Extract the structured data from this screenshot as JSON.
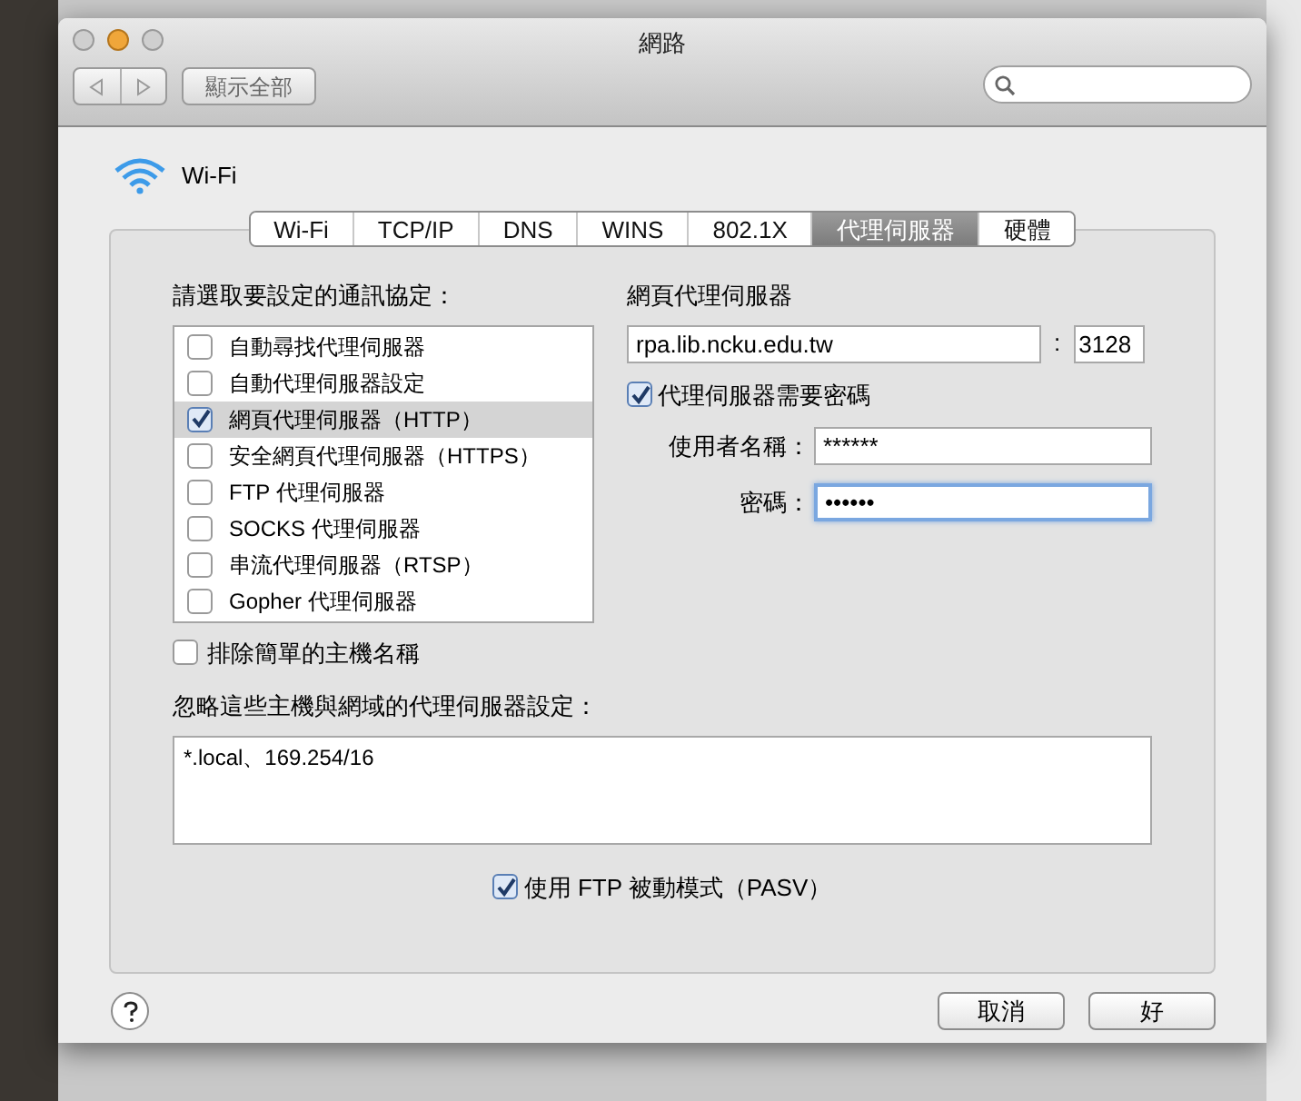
{
  "window": {
    "title": "網路"
  },
  "toolbar": {
    "show_all": "顯示全部"
  },
  "service": {
    "name": "Wi-Fi"
  },
  "tabs": [
    {
      "label": "Wi-Fi",
      "selected": false
    },
    {
      "label": "TCP/IP",
      "selected": false
    },
    {
      "label": "DNS",
      "selected": false
    },
    {
      "label": "WINS",
      "selected": false
    },
    {
      "label": "802.1X",
      "selected": false
    },
    {
      "label": "代理伺服器",
      "selected": true
    },
    {
      "label": "硬體",
      "selected": false
    }
  ],
  "protocols": {
    "label": "請選取要設定的通訊協定：",
    "items": [
      {
        "label": "自動尋找代理伺服器",
        "checked": false,
        "selected": false
      },
      {
        "label": "自動代理伺服器設定",
        "checked": false,
        "selected": false
      },
      {
        "label": "網頁代理伺服器（HTTP）",
        "checked": true,
        "selected": true
      },
      {
        "label": "安全網頁代理伺服器（HTTPS）",
        "checked": false,
        "selected": false
      },
      {
        "label": "FTP 代理伺服器",
        "checked": false,
        "selected": false
      },
      {
        "label": "SOCKS 代理伺服器",
        "checked": false,
        "selected": false
      },
      {
        "label": "串流代理伺服器（RTSP）",
        "checked": false,
        "selected": false
      },
      {
        "label": "Gopher 代理伺服器",
        "checked": false,
        "selected": false
      }
    ]
  },
  "proxy": {
    "label": "網頁代理伺服器",
    "host": "rpa.lib.ncku.edu.tw",
    "separator": ":",
    "port": "3128",
    "require_password": {
      "label": "代理伺服器需要密碼",
      "checked": true
    },
    "username": {
      "label": "使用者名稱：",
      "value": "******",
      "focused": false
    },
    "password": {
      "label": "密碼：",
      "value": "••••••",
      "focused": true
    }
  },
  "exclude_simple": {
    "label": "排除簡單的主機名稱",
    "checked": false
  },
  "bypass": {
    "label": "忽略這些主機與網域的代理伺服器設定：",
    "value": "*.local、169.254/16"
  },
  "pasv": {
    "label": "使用 FTP 被動模式（PASV）",
    "checked": true
  },
  "buttons": [
    {
      "label": "取消"
    },
    {
      "label": "好"
    }
  ]
}
